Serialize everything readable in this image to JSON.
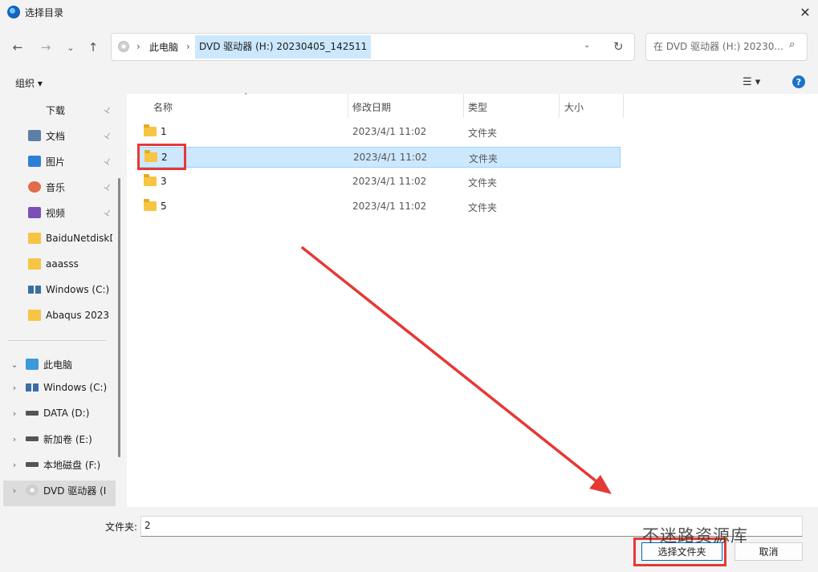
{
  "window": {
    "title": "选择目录",
    "close_glyph": "✕"
  },
  "nav": {
    "back_glyph": "←",
    "forward_glyph": "→",
    "recent_glyph": "⌄",
    "up_glyph": "↑",
    "crumb_sep": "›",
    "crumbs": [
      "此电脑",
      "DVD 驱动器 (H:) 20230405_142511"
    ],
    "dropdown_glyph": "⌄",
    "refresh_glyph": "↻",
    "search_placeholder": "在 DVD 驱动器 (H:) 20230...",
    "search_glyph": "⌕"
  },
  "command": {
    "organize_label": "组织 ▾",
    "view_glyph": "☰ ▾",
    "help_glyph": "?"
  },
  "sidebar": {
    "quick": [
      {
        "label": "下载",
        "icon": "download-icon",
        "pinned": true
      },
      {
        "label": "文档",
        "icon": "document-icon",
        "pinned": true
      },
      {
        "label": "图片",
        "icon": "picture-icon",
        "pinned": true
      },
      {
        "label": "音乐",
        "icon": "music-icon",
        "pinned": true
      },
      {
        "label": "视频",
        "icon": "video-icon",
        "pinned": true
      },
      {
        "label": "BaiduNetdiskD",
        "icon": "folder-icon",
        "pinned": false
      },
      {
        "label": "aaasss",
        "icon": "folder-icon",
        "pinned": false
      },
      {
        "label": "Windows (C:)",
        "icon": "windows-drive-icon",
        "pinned": false
      },
      {
        "label": "Abaqus 2023",
        "icon": "folder-icon",
        "pinned": false
      }
    ],
    "pin_glyph": "📌",
    "this_pc": "此电脑",
    "drives": [
      {
        "label": "Windows (C:)",
        "icon": "windows-drive-icon"
      },
      {
        "label": "DATA (D:)",
        "icon": "drive-icon"
      },
      {
        "label": "新加卷 (E:)",
        "icon": "drive-icon"
      },
      {
        "label": "本地磁盘 (F:)",
        "icon": "drive-icon"
      },
      {
        "label": "DVD 驱动器 (I",
        "icon": "dvd-icon"
      }
    ],
    "expand_glyph": "›",
    "collapse_glyph": "⌄"
  },
  "filelist": {
    "columns": {
      "name": "名称",
      "date": "修改日期",
      "type": "类型",
      "size": "大小"
    },
    "sort_glyph": "˄",
    "rows": [
      {
        "name": "1",
        "date": "2023/4/1 11:02",
        "type": "文件夹",
        "selected": false
      },
      {
        "name": "2",
        "date": "2023/4/1 11:02",
        "type": "文件夹",
        "selected": true
      },
      {
        "name": "3",
        "date": "2023/4/1 11:02",
        "type": "文件夹",
        "selected": false
      },
      {
        "name": "5",
        "date": "2023/4/1 11:02",
        "type": "文件夹",
        "selected": false
      }
    ]
  },
  "footer": {
    "folder_label": "文件夹:",
    "folder_value": "2",
    "select_button": "选择文件夹",
    "cancel_button": "取消"
  },
  "watermark": {
    "text": "不迷路资源库"
  },
  "colors": {
    "accent": "#0067c0",
    "selection": "#cce8ff",
    "annotation": "#e53935"
  }
}
